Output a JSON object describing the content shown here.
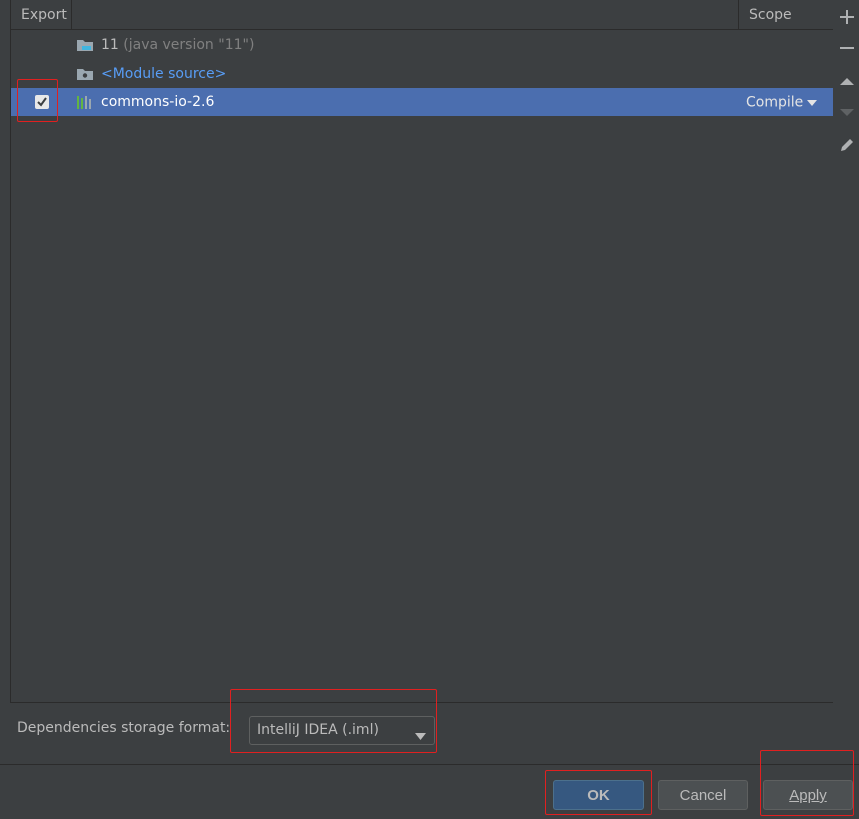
{
  "table": {
    "columns": {
      "export": "Export",
      "scope": "Scope"
    },
    "rows": [
      {
        "icon": "jdk-folder-icon",
        "label": "11",
        "sub": "(java version \"11\")"
      },
      {
        "icon": "module-source-folder-icon",
        "label": "<Module source>"
      },
      {
        "icon": "library-icon",
        "label": "commons-io-2.6",
        "exported": true,
        "scope": "Compile",
        "selected": true
      }
    ]
  },
  "toolbar": [
    "add-icon",
    "remove-icon",
    "move-up-icon",
    "move-down-icon",
    "edit-icon"
  ],
  "storage": {
    "label": "Dependencies storage format:",
    "value": "IntelliJ IDEA (.iml)"
  },
  "buttons": {
    "ok": "OK",
    "cancel": "Cancel",
    "apply": "Apply"
  },
  "colors": {
    "selection": "#4b6eaf",
    "highlight_box": "#e02020",
    "link": "#589df6"
  }
}
